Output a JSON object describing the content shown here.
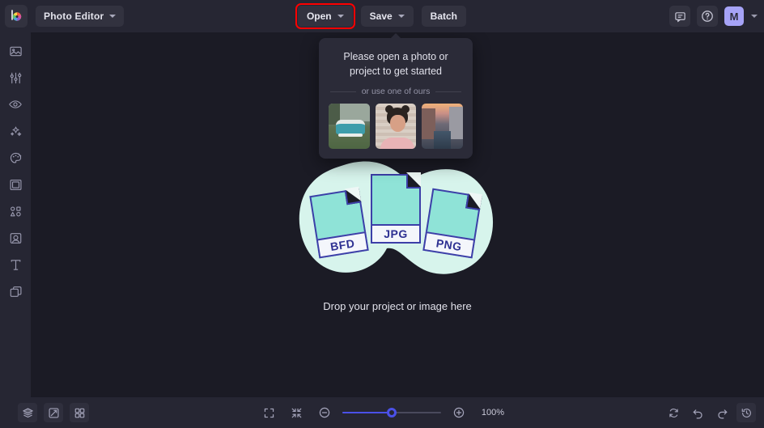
{
  "app": {
    "name": "Photo Editor",
    "logo_icon": "befunky-color-wheel-logo"
  },
  "topbar": {
    "app_menu_label": "Photo Editor",
    "buttons": [
      {
        "label": "Open",
        "icon": "chevron-down-icon",
        "highlighted": true
      },
      {
        "label": "Save",
        "icon": "chevron-down-icon",
        "highlighted": false
      },
      {
        "label": "Batch",
        "icon": "",
        "highlighted": false
      }
    ],
    "feedback_icon": "chat-bubble-icon",
    "help_icon": "question-circle-icon",
    "avatar_initial": "M",
    "avatar_color": "#a6a3f7",
    "highlight_color": "#ff0000"
  },
  "sidebar": {
    "items": [
      {
        "icon": "image-icon",
        "name": "edit"
      },
      {
        "icon": "sliders-icon",
        "name": "adjust"
      },
      {
        "icon": "eye-icon",
        "name": "retouch"
      },
      {
        "icon": "sparkles-icon",
        "name": "effects"
      },
      {
        "icon": "palette-icon",
        "name": "artsy"
      },
      {
        "icon": "frame-icon",
        "name": "frames"
      },
      {
        "icon": "shapes-icon",
        "name": "graphics"
      },
      {
        "icon": "portrait-icon",
        "name": "overlays"
      },
      {
        "icon": "text-icon",
        "name": "text"
      },
      {
        "icon": "layers-icon",
        "name": "layers"
      }
    ]
  },
  "popover": {
    "title": "Please open a photo or project to get started",
    "divider_label": "or use one of ours",
    "samples": [
      {
        "name": "vw-bus-sample"
      },
      {
        "name": "portrait-sample"
      },
      {
        "name": "canal-sample"
      }
    ]
  },
  "dropzone": {
    "files": [
      {
        "label": "BFD"
      },
      {
        "label": "JPG"
      },
      {
        "label": "PNG"
      }
    ],
    "caption": "Drop your project or image here",
    "blob_color": "#d7f4ec",
    "file_color": "#8fe3d7",
    "file_border": "#3c3fa8"
  },
  "bottombar": {
    "left_icons": [
      {
        "icon": "layers-stack-icon",
        "name": "layers-panel"
      },
      {
        "icon": "compare-icon",
        "name": "compare-view"
      },
      {
        "icon": "grid-icon",
        "name": "grid-view"
      }
    ],
    "center_icons": [
      {
        "icon": "fullscreen-icon",
        "name": "fullscreen"
      },
      {
        "icon": "fit-screen-icon",
        "name": "fit-to-screen"
      }
    ],
    "zoom_out_icon": "minus-circle-icon",
    "zoom_in_icon": "plus-circle-icon",
    "zoom_value": "100%",
    "slider_percent": 50,
    "slider_color": "#4b51e8",
    "right_icons": [
      {
        "icon": "reset-icon",
        "name": "reset"
      },
      {
        "icon": "undo-icon",
        "name": "undo"
      },
      {
        "icon": "redo-icon",
        "name": "redo"
      },
      {
        "icon": "history-icon",
        "name": "history"
      }
    ]
  }
}
